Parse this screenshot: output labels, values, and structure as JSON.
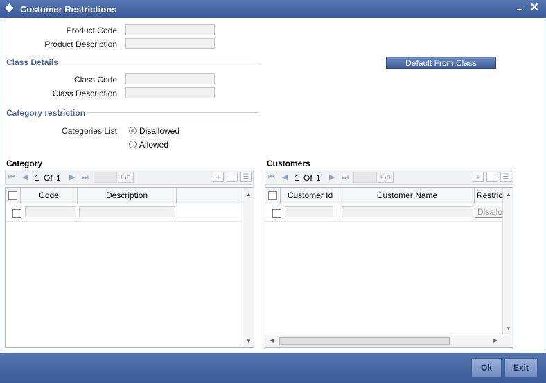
{
  "window": {
    "title": "Customer Restrictions"
  },
  "fields": {
    "product_code": {
      "label": "Product Code",
      "value": ""
    },
    "product_description": {
      "label": "Product Description",
      "value": ""
    },
    "class_code": {
      "label": "Class Code",
      "value": ""
    },
    "class_description": {
      "label": "Class Description",
      "value": ""
    }
  },
  "sections": {
    "class_details": "Class Details",
    "category_restriction": "Category restriction"
  },
  "default_from_class_label": "Default From Class",
  "categories_list": {
    "label": "Categories List",
    "options": [
      "Disallowed",
      "Allowed"
    ],
    "selected": "Disallowed"
  },
  "category_grid": {
    "title": "Category",
    "pager": {
      "current": "1",
      "of_label": "Of",
      "total": "1",
      "go_label": "Go"
    },
    "columns": [
      "Code",
      "Description"
    ]
  },
  "customers_grid": {
    "title": "Customers",
    "pager": {
      "current": "1",
      "of_label": "Of",
      "total": "1",
      "go_label": "Go"
    },
    "columns": [
      "Customer Id",
      "Customer Name",
      "Restric"
    ],
    "row_restriction_value": "Disallo"
  },
  "footer": {
    "ok_label": "Ok",
    "exit_label": "Exit"
  },
  "colors": {
    "title_bar": "#3a5a9b",
    "section_text": "#4a6aa5",
    "button": "#4f6fad"
  }
}
